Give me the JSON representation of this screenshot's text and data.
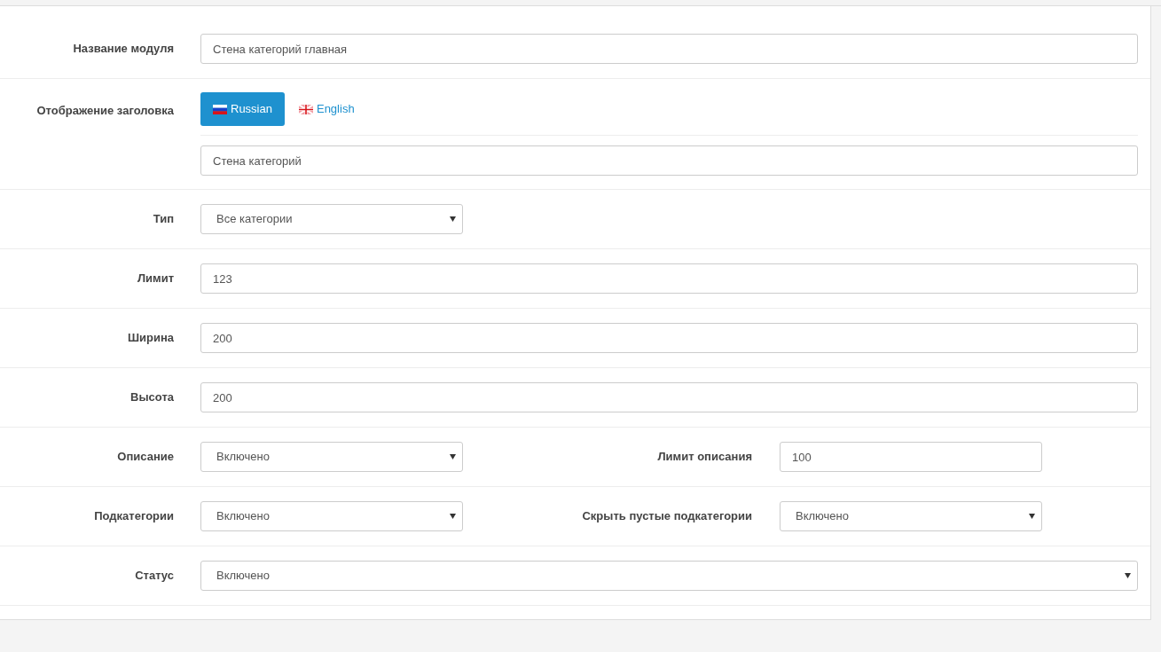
{
  "form": {
    "rows": [
      {
        "kind": "field",
        "fields": [
          {
            "label": "Название модуля",
            "kind": "input",
            "compact": false,
            "value": "Стена категорий главная"
          }
        ]
      },
      {
        "kind": "language",
        "label": "Отображение заголовка",
        "tabs": [
          {
            "label": "Russian",
            "kind": "ru",
            "selected": true
          },
          {
            "label": "English",
            "kind": "gb",
            "selected": false
          }
        ],
        "value": "Стена категорий"
      },
      {
        "kind": "field",
        "fields": [
          {
            "label": "Тип",
            "kind": "select",
            "compact": true,
            "value": "Все категории"
          }
        ]
      },
      {
        "kind": "field",
        "fields": [
          {
            "label": "Лимит",
            "kind": "input",
            "compact": false,
            "value": "123"
          }
        ]
      },
      {
        "kind": "field",
        "fields": [
          {
            "label": "Ширина",
            "kind": "input",
            "compact": false,
            "value": "200"
          }
        ]
      },
      {
        "kind": "field",
        "fields": [
          {
            "label": "Высота",
            "kind": "input",
            "compact": false,
            "value": "200"
          }
        ]
      },
      {
        "kind": "field",
        "fields": [
          {
            "label": "Описание",
            "kind": "select",
            "compact": true,
            "value": "Включено"
          },
          {
            "label": "Лимит описания",
            "kind": "input",
            "compact": true,
            "value": "100"
          }
        ]
      },
      {
        "kind": "field",
        "fields": [
          {
            "label": "Подкатегории",
            "kind": "select",
            "compact": true,
            "value": "Включено"
          },
          {
            "label": "Скрыть пустые подкатегории",
            "kind": "select",
            "compact": true,
            "value": "Включено"
          }
        ]
      },
      {
        "kind": "field",
        "fields": [
          {
            "label": "Статус",
            "kind": "select",
            "compact": false,
            "value": "Включено"
          }
        ]
      }
    ]
  }
}
